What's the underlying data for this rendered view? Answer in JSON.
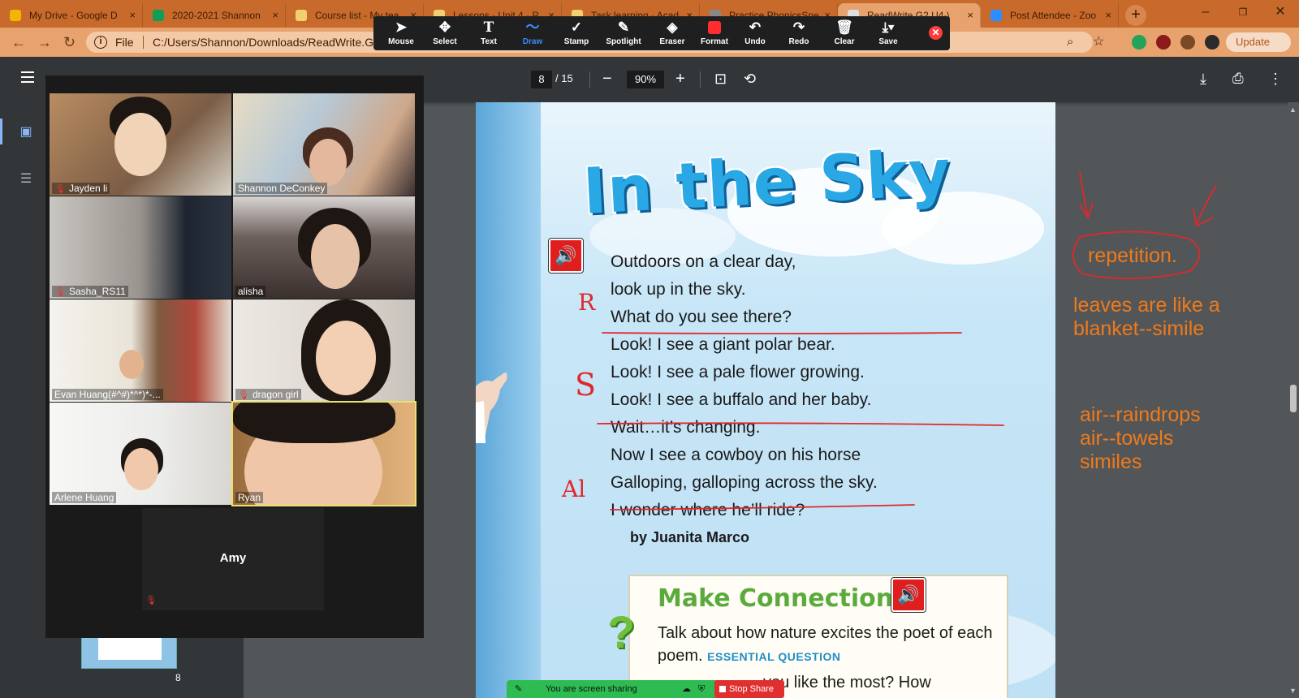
{
  "browser": {
    "tabs": [
      {
        "label": "My Drive - Google D",
        "favicon_color": "#f4b400"
      },
      {
        "label": "2020-2021 Shannon",
        "favicon_color": "#0f9d58"
      },
      {
        "label": "Course list - My tea",
        "favicon_color": "#f0d070"
      },
      {
        "label": "Lessons - Unit 4 - R",
        "favicon_color": "#f0d070"
      },
      {
        "label": "Task learning - Acad",
        "favicon_color": "#f0d070"
      },
      {
        "label": "Practice PhonicsSpe",
        "favicon_color": "#888888"
      },
      {
        "label": "ReadWrite.G2.U4-\\",
        "favicon_color": "#e0e0e0"
      },
      {
        "label": "Post Attendee - Zoo",
        "favicon_color": "#2d8cff"
      }
    ],
    "url_scheme": "File",
    "url": "C:/Users/Shannon/Downloads/ReadWrite.G2.",
    "update_label": "Update"
  },
  "annotate_toolbar": {
    "tools": [
      {
        "label": "Mouse",
        "icon": "cursor-icon"
      },
      {
        "label": "Select",
        "icon": "move-icon"
      },
      {
        "label": "Text",
        "icon": "text-icon"
      },
      {
        "label": "Draw",
        "icon": "draw-icon"
      },
      {
        "label": "Stamp",
        "icon": "check-icon"
      },
      {
        "label": "Spotlight",
        "icon": "spotlight-icon"
      },
      {
        "label": "Eraser",
        "icon": "eraser-icon"
      },
      {
        "label": "Format",
        "icon": "format-icon"
      },
      {
        "label": "Undo",
        "icon": "undo-icon"
      },
      {
        "label": "Redo",
        "icon": "redo-icon"
      },
      {
        "label": "Clear",
        "icon": "trash-icon"
      },
      {
        "label": "Save",
        "icon": "save-icon"
      }
    ],
    "active_tool": "Draw",
    "format_color": "#ff2d2d"
  },
  "pdf_viewer": {
    "current_page": "8",
    "total_pages": "/ 15",
    "zoom": "90%",
    "thumbnail_page": "8"
  },
  "participants": [
    {
      "name": "Jayden li",
      "muted": true
    },
    {
      "name": "Shannon DeConkey",
      "muted": false
    },
    {
      "name": "Sasha_RS11",
      "muted": true
    },
    {
      "name": "alisha",
      "muted": false
    },
    {
      "name": "Evan Huang(#^#)*^*)*-...",
      "muted": false
    },
    {
      "name": "dragon girl",
      "muted": true
    },
    {
      "name": "Arlene Huang",
      "muted": false
    },
    {
      "name": "Ryan",
      "muted": false,
      "speaking": true
    }
  ],
  "audio_only_participant": {
    "name": "Amy",
    "muted": true
  },
  "page": {
    "title": "In the Sky",
    "poem_lines": [
      "Outdoors on a clear day,",
      "look up in the sky.",
      "What do you see there?",
      "Look! I see a giant polar bear.",
      "Look! I see a pale flower growing.",
      "Look! I see a buffalo and her baby.",
      "Wait…it’s changing.",
      "Now I see a cowboy on his horse",
      "Galloping, galloping across the sky.",
      "I wonder where he’ll ride?"
    ],
    "byline": "by Juanita Marco",
    "make_connections": {
      "title": "Make Connections",
      "text": "Talk about how nature excites the poet of each poem.",
      "essential_question": "ESSENTIAL QUESTION",
      "cut_line": "you like the most? How"
    }
  },
  "annotations": {
    "margin_marks": [
      "R",
      "S",
      "Al"
    ],
    "notes": [
      "repetition.",
      "leaves are like a",
      "blanket--simile",
      "air--raindrops",
      "air--towels",
      "similes"
    ],
    "pen_color": "#e0282b",
    "note_color": "#f07a1a"
  },
  "screen_share": {
    "status": "You are screen sharing",
    "stop_label": "Stop Share"
  }
}
